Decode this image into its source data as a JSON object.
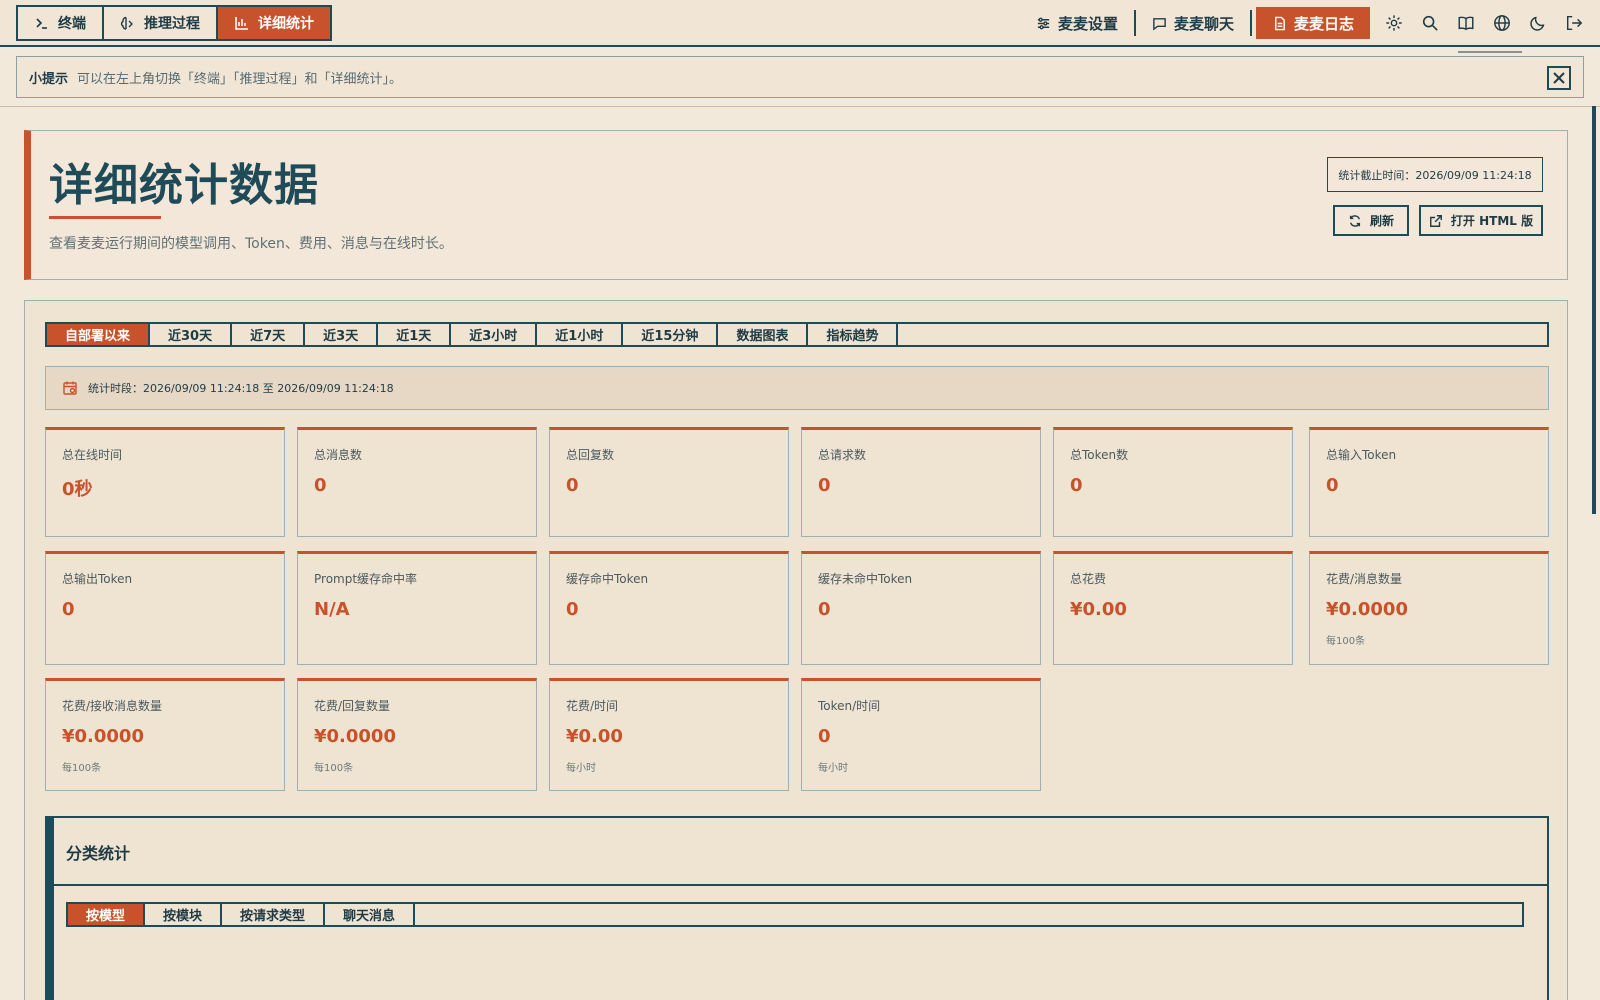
{
  "mode_tabs": [
    {
      "label": "终端",
      "icon": "terminal-icon"
    },
    {
      "label": "推理过程",
      "icon": "brain-icon"
    },
    {
      "label": "详细统计",
      "icon": "bar-chart-icon",
      "active": true
    }
  ],
  "top_nav": {
    "settings_label": "麦麦设置",
    "chat_label": "麦麦聊天",
    "log_label": "麦麦日志",
    "icons": [
      "gear-icon",
      "search-icon",
      "book-icon",
      "globe-icon",
      "moon-icon",
      "logout-icon"
    ]
  },
  "hint": {
    "label": "小提示",
    "text": "可以在左上角切换「终端」「推理过程」和「详细统计」。"
  },
  "header": {
    "title": "详细统计数据",
    "description": "查看麦麦运行期间的模型调用、Token、费用、消息与在线时长。",
    "stat_time": "统计截止时间：2026/09/09 11:24:18",
    "refresh_label": "刷新",
    "open_html_label": "打开 HTML 版"
  },
  "range_tabs": [
    "自部署以来",
    "近30天",
    "近7天",
    "近3天",
    "近1天",
    "近3小时",
    "近1小时",
    "近15分钟",
    "数据图表",
    "指标趋势"
  ],
  "period": "统计时段：2026/09/09 11:24:18 至 2026/09/09 11:24:18",
  "metrics": [
    {
      "label": "总在线时间",
      "value": "0秒"
    },
    {
      "label": "总消息数",
      "value": "0"
    },
    {
      "label": "总回复数",
      "value": "0"
    },
    {
      "label": "总请求数",
      "value": "0"
    },
    {
      "label": "总Token数",
      "value": "0"
    },
    {
      "label": "总输入Token",
      "value": "0"
    },
    {
      "label": "总输出Token",
      "value": "0"
    },
    {
      "label": "Prompt缓存命中率",
      "value": "N/A"
    },
    {
      "label": "缓存命中Token",
      "value": "0"
    },
    {
      "label": "缓存未命中Token",
      "value": "0"
    },
    {
      "label": "总花费",
      "value": "¥0.00"
    },
    {
      "label": "花费/消息数量",
      "value": "¥0.0000",
      "sub": "每100条"
    },
    {
      "label": "花费/接收消息数量",
      "value": "¥0.0000",
      "sub": "每100条"
    },
    {
      "label": "花费/回复数量",
      "value": "¥0.0000",
      "sub": "每100条"
    },
    {
      "label": "花费/时间",
      "value": "¥0.00",
      "sub": "每小时"
    },
    {
      "label": "Token/时间",
      "value": "0",
      "sub": "每小时"
    }
  ],
  "category": {
    "title": "分类统计",
    "tabs": [
      "按模型",
      "按模块",
      "按请求类型",
      "聊天消息"
    ]
  },
  "colors": {
    "accent": "#c8522b",
    "primary": "#1f4b59",
    "background": "#f3e9da"
  }
}
